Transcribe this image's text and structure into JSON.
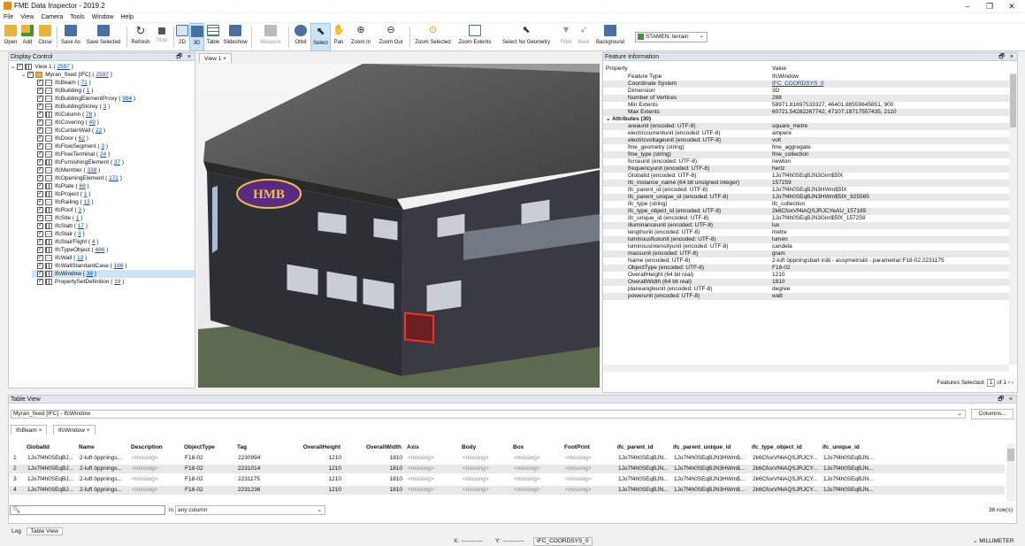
{
  "window": {
    "title": "FME Data Inspector - 2019.2",
    "min": "–",
    "max": "❐",
    "close": "✕"
  },
  "menu": [
    "File",
    "View",
    "Camera",
    "Tools",
    "Window",
    "Help"
  ],
  "toolbar": {
    "items": [
      "Open",
      "Add",
      "Close",
      "Save As",
      "Save Selected",
      "Refresh",
      "Stop",
      "2D",
      "3D",
      "Table",
      "Slideshow",
      "Measure",
      "Orbit",
      "Select",
      "Pan",
      "Zoom In",
      "Zoom Out",
      "Zoom Selected",
      "Zoom Extents",
      "Select No Geometry",
      "Filter",
      "Mark",
      "Background"
    ],
    "background_map": "STAMEN: terrain",
    "bg_chevron": "⌄"
  },
  "display_control": {
    "title": "Display Control",
    "pin": "🗗",
    "close": "×",
    "tree": [
      {
        "label": "View 1 ( ",
        "count": "2597",
        "end": " )",
        "level": 0,
        "exp": "⌄"
      },
      {
        "label": "Myran_fixed [IFC] ( ",
        "count": "2597",
        "end": " )",
        "level": 1,
        "exp": "⌄"
      },
      {
        "label": "IfcBeam ( ",
        "count": "71",
        "end": " )",
        "level": 2
      },
      {
        "label": "IfcBuilding ( ",
        "count": "1",
        "end": " )",
        "level": 2
      },
      {
        "label": "IfcBuildingElementProxy ( ",
        "count": "984",
        "end": " )",
        "level": 2
      },
      {
        "label": "IfcBuildingStorey ( ",
        "count": "3",
        "end": " )",
        "level": 2
      },
      {
        "label": "IfcColumn ( ",
        "count": "78",
        "end": " )",
        "level": 2
      },
      {
        "label": "IfcCovering ( ",
        "count": "49",
        "end": " )",
        "level": 2
      },
      {
        "label": "IfcCurtainWall ( ",
        "count": "22",
        "end": " )",
        "level": 2
      },
      {
        "label": "IfcDoor ( ",
        "count": "62",
        "end": " )",
        "level": 2
      },
      {
        "label": "IfcFlowSegment ( ",
        "count": "3",
        "end": " )",
        "level": 2
      },
      {
        "label": "IfcFlowTerminal ( ",
        "count": "24",
        "end": " )",
        "level": 2
      },
      {
        "label": "IfcFurnishingElement ( ",
        "count": "37",
        "end": " )",
        "level": 2
      },
      {
        "label": "IfcMember ( ",
        "count": "338",
        "end": " )",
        "level": 2
      },
      {
        "label": "IfcOpeningElement ( ",
        "count": "172",
        "end": " )",
        "level": 2
      },
      {
        "label": "IfcPlate ( ",
        "count": "69",
        "end": " )",
        "level": 2
      },
      {
        "label": "IfcProject ( ",
        "count": "1",
        "end": " )",
        "level": 2
      },
      {
        "label": "IfcRailing ( ",
        "count": "13",
        "end": " )",
        "level": 2
      },
      {
        "label": "IfcRoof ( ",
        "count": "3",
        "end": " )",
        "level": 2
      },
      {
        "label": "IfcSite ( ",
        "count": "1",
        "end": " )",
        "level": 2
      },
      {
        "label": "IfcSlab ( ",
        "count": "17",
        "end": " )",
        "level": 2
      },
      {
        "label": "IfcStair ( ",
        "count": "3",
        "end": " )",
        "level": 2
      },
      {
        "label": "IfcStairFlight ( ",
        "count": "4",
        "end": " )",
        "level": 2
      },
      {
        "label": "IfcTypeObject ( ",
        "count": "486",
        "end": " )",
        "level": 2
      },
      {
        "label": "IfcWall ( ",
        "count": "13",
        "end": " )",
        "level": 2
      },
      {
        "label": "IfcWallStandardCase ( ",
        "count": "186",
        "end": " )",
        "level": 2
      },
      {
        "label": "IfcWindow ( ",
        "count": "38",
        "end": " )",
        "level": 2,
        "selected": true
      },
      {
        "label": "PropertySetDefinition ( ",
        "count": "19",
        "end": " )",
        "level": 2
      }
    ]
  },
  "view": {
    "tab": "View 1",
    "close": "×",
    "sign": "HMB"
  },
  "feature_info": {
    "title": "Feature Information",
    "col_property": "Property",
    "col_value": "Value",
    "pin": "🗗",
    "close": "×",
    "rows": [
      {
        "k": "Feature Type",
        "v": "IfcWindow"
      },
      {
        "k": "Coordinate System",
        "v": "IFC_COORDSYS_0",
        "link": true
      },
      {
        "k": "Dimension",
        "v": "3D"
      },
      {
        "k": "Number of Vertices",
        "v": "288"
      },
      {
        "k": "Min Extents",
        "v": "58971.81697533327, 46401.88559645851, 900"
      },
      {
        "k": "Max Extents",
        "v": "60721.54282267742, 47107.18717557435, 2110"
      },
      {
        "k": "Attributes (30)",
        "v": "",
        "group": true
      },
      {
        "k": "areaunit (encoded: UTF-8)",
        "v": "square_metre"
      },
      {
        "k": "electriccurrentunit (encoded: UTF-8)",
        "v": "ampere"
      },
      {
        "k": "electricvoltageunit (encoded: UTF-8)",
        "v": "volt"
      },
      {
        "k": "fme_geometry (string)",
        "v": "fme_aggregate"
      },
      {
        "k": "fme_type (string)",
        "v": "fme_collection"
      },
      {
        "k": "forceunit (encoded: UTF-8)",
        "v": "newton"
      },
      {
        "k": "frequencyunit (encoded: UTF-8)",
        "v": "hertz"
      },
      {
        "k": "GlobalId (encoded: UTF-8)",
        "v": "1Jo7f4h0SEqBJN3Gim$5fX"
      },
      {
        "k": "ifc_instance_name (64 bit unsigned integer)",
        "v": "157259"
      },
      {
        "k": "ifc_parent_id (encoded: UTF-8)",
        "v": "1Jo7f4h0SEqBJN3HWm$5fX"
      },
      {
        "k": "ifc_parent_unique_id (encoded: UTF-8)",
        "v": "1Jo7f4h0SEqBJN3HWm$5fX_925565"
      },
      {
        "k": "ifc_type (string)",
        "v": "ifc_collection"
      },
      {
        "k": "ifc_type_object_id (encoded: UTF-8)",
        "v": "2k6CfoxVf4iAQSJRJCYeAU_157185"
      },
      {
        "k": "ifc_unique_id (encoded: UTF-8)",
        "v": "1Jo7f4h0SEqBJN3Gim$5fX_157259"
      },
      {
        "k": "illuminanceunit (encoded: UTF-8)",
        "v": "lux"
      },
      {
        "k": "lengthunit (encoded: UTF-8)",
        "v": "metre"
      },
      {
        "k": "luminousfluxunit (encoded: UTF-8)",
        "v": "lumen"
      },
      {
        "k": "luminousintensityunit (encoded: UTF-8)",
        "v": "candela"
      },
      {
        "k": "massunit (encoded: UTF-8)",
        "v": "gram"
      },
      {
        "k": "Name (encoded: UTF-8)",
        "v": "2-luft öppningsbart inåt - assymetriskt - parametrar:F18-02:2231175"
      },
      {
        "k": "ObjectType (encoded: UTF-8)",
        "v": "F18-02"
      },
      {
        "k": "OverallHeight (64 bit real)",
        "v": "1210"
      },
      {
        "k": "OverallWidth (64 bit real)",
        "v": "1810"
      },
      {
        "k": "planeangleunit (encoded: UTF-8)",
        "v": "degree"
      },
      {
        "k": "powerunit (encoded: UTF-8)",
        "v": "watt"
      }
    ],
    "features_selected_label": "Features Selected:",
    "features_selected_value": "1",
    "of": "of 1",
    "prev": "‹",
    "next": "›"
  },
  "table_view": {
    "title": "Table View",
    "pin": "🗗",
    "close": "×",
    "dataset": "Myran_fixed [IFC] - IfcWindow",
    "columns_btn": "Columns...",
    "tabs": [
      {
        "label": "IfcBeam",
        "close": "×"
      },
      {
        "label": "IfcWindow",
        "close": "×"
      }
    ],
    "headers": [
      "GlobalId",
      "Name",
      "Description",
      "ObjectType",
      "Tag",
      "OverallHeight",
      "OverallWidth",
      "Axis",
      "Body",
      "Box",
      "FootPrint",
      "ifc_parent_id",
      "ifc_parent_unique_id",
      "ifc_type_object_id",
      "ifc_unique_id"
    ],
    "rows": [
      [
        "1",
        "1Jo7f4h0SEqBJ...",
        "2-luft öppnings...",
        "<missing>",
        "F18-02",
        "2230994",
        "1210",
        "1810",
        "<missing>",
        "<missing>",
        "<missing>",
        "<missing>",
        "1Jo7f4h0SEqBJN...",
        "1Jo7f4h0SEqBJN3HWm$...",
        "2k6CfoxVf4iAQSJRJCY...",
        "1Jo7f4h0SEqBJN..."
      ],
      [
        "2",
        "1Jo7f4h0SEqBJ...",
        "2-luft öppnings...",
        "<missing>",
        "F18-02",
        "2231014",
        "1210",
        "1810",
        "<missing>",
        "<missing>",
        "<missing>",
        "<missing>",
        "1Jo7f4h0SEqBJN...",
        "1Jo7f4h0SEqBJN3HWm$...",
        "2k6CfoxVf4iAQSJRJCY...",
        "1Jo7f4h0SEqBJN..."
      ],
      [
        "3",
        "1Jo7f4h0SEqBJ...",
        "2-luft öppnings...",
        "<missing>",
        "F18-02",
        "2231175",
        "1210",
        "1810",
        "<missing>",
        "<missing>",
        "<missing>",
        "<missing>",
        "1Jo7f4h0SEqBJN...",
        "1Jo7f4h0SEqBJN3HWm$...",
        "2k6CfoxVf4iAQSJRJCY...",
        "1Jo7f4h0SEqBJN..."
      ],
      [
        "4",
        "1Jo7f4h0SEqBJ...",
        "2-luft öppnings...",
        "<missing>",
        "F18-02",
        "2231236",
        "1210",
        "1810",
        "<missing>",
        "<missing>",
        "<missing>",
        "<missing>",
        "1Jo7f4h0SEqBJN...",
        "1Jo7f4h0SEqBJN3HWm$...",
        "2k6CfoxVf4iAQSJRJCY...",
        "1Jo7f4h0SEqBJN..."
      ]
    ],
    "search_in": "in",
    "search_scope": "any column",
    "row_count": "38 row(s)"
  },
  "bottom_tabs": [
    "Log",
    "Table View"
  ],
  "status": {
    "x_label": "X:",
    "x_val": "-----------",
    "y_label": "Y:",
    "y_val": "-----------",
    "coordsys": "IFC_COORDSYS_0",
    "units": "MILLIMETER"
  },
  "colors": {
    "accent": "#cce4f7",
    "link": "#0645ad",
    "header": "#dfe6ee"
  }
}
